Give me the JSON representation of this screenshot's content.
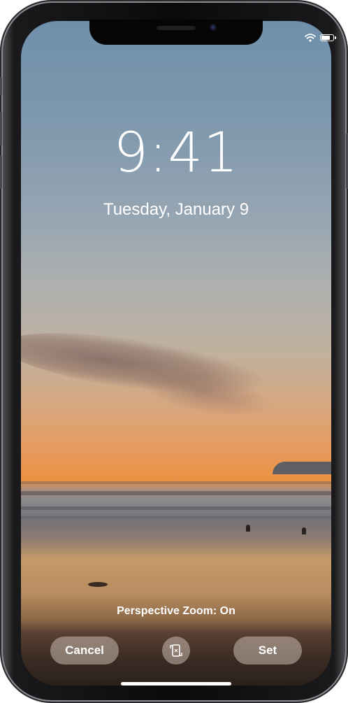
{
  "lock_screen": {
    "time": "9:41",
    "date": "Tuesday, January 9"
  },
  "status_bar": {
    "wifi_icon": "wifi-icon",
    "battery_icon": "battery-icon",
    "battery_level_fraction": 0.85
  },
  "wallpaper_preview": {
    "perspective_zoom_label": "Perspective Zoom: On",
    "cancel_label": "Cancel",
    "set_label": "Set",
    "perspective_toggle_icon": "perspective-zoom-icon"
  },
  "colors": {
    "text": "#ffffff",
    "button_bg": "rgba(200,185,175,0.55)",
    "frame": "#0a0a0b"
  }
}
